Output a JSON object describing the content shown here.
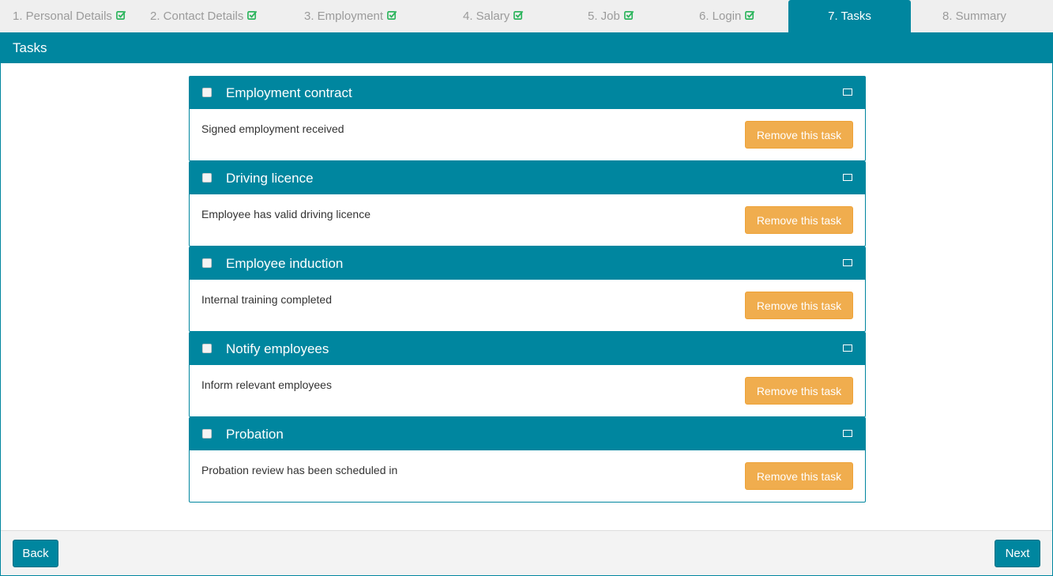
{
  "steps": [
    {
      "label": "1. Personal Details",
      "done": true
    },
    {
      "label": "2. Contact Details",
      "done": true
    },
    {
      "label": "3. Employment",
      "done": true
    },
    {
      "label": "4. Salary",
      "done": true
    },
    {
      "label": "5. Job",
      "done": true
    },
    {
      "label": "6. Login",
      "done": true
    },
    {
      "label": "7. Tasks",
      "done": false,
      "active": true
    },
    {
      "label": "8. Summary",
      "done": false
    }
  ],
  "panel": {
    "title": "Tasks"
  },
  "tasks": [
    {
      "title": "Employment contract",
      "description": "Signed employment received",
      "remove_label": "Remove this task"
    },
    {
      "title": "Driving licence",
      "description": "Employee has valid driving licence",
      "remove_label": "Remove this task"
    },
    {
      "title": "Employee induction",
      "description": "Internal training completed",
      "remove_label": "Remove this task"
    },
    {
      "title": "Notify employees",
      "description": "Inform relevant employees",
      "remove_label": "Remove this task"
    },
    {
      "title": "Probation",
      "description": "Probation review has been scheduled in",
      "remove_label": "Remove this task"
    }
  ],
  "footer": {
    "back_label": "Back",
    "next_label": "Next"
  },
  "colors": {
    "accent": "#00869f",
    "warning": "#f0ad4e",
    "check": "#2db55d",
    "step_text": "#9b9b9b"
  },
  "icons": {
    "step_done": "check-square-icon",
    "task_toggle": "minimize-icon"
  }
}
